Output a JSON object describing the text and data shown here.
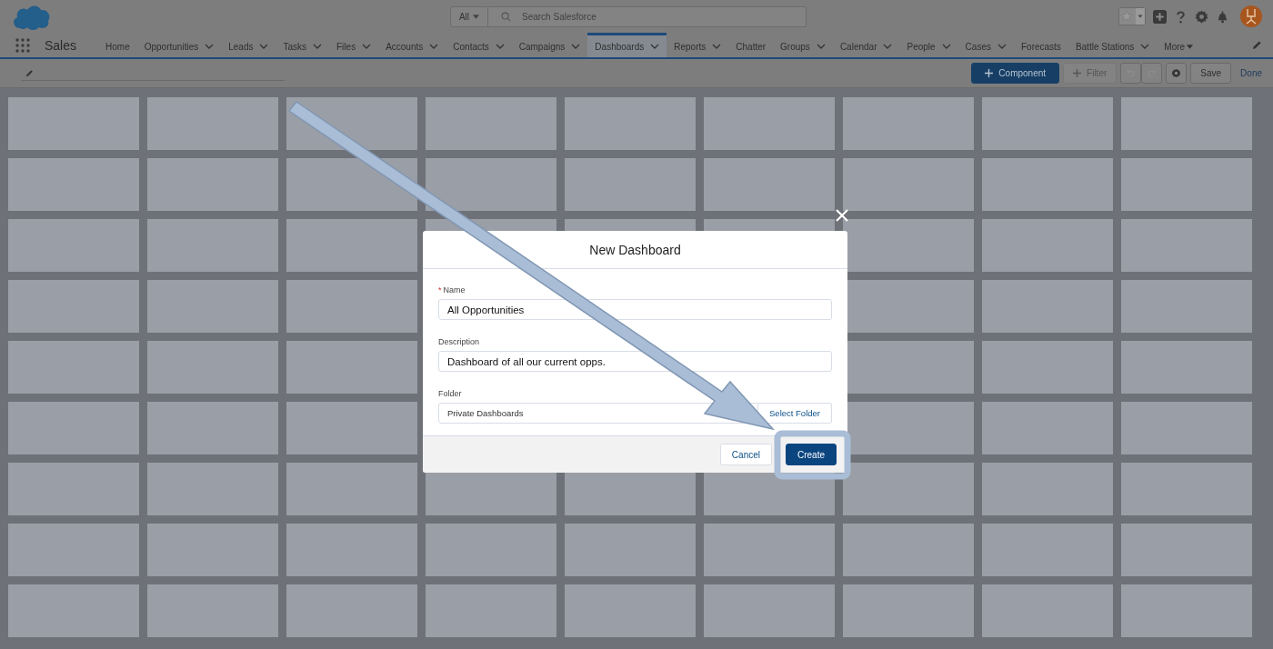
{
  "header": {
    "search_scope": "All",
    "search_placeholder": "Search Salesforce"
  },
  "app_name": "Sales",
  "nav": [
    {
      "label": "Home",
      "menu": false,
      "selected": false
    },
    {
      "label": "Opportunities",
      "menu": true,
      "selected": false
    },
    {
      "label": "Leads",
      "menu": true,
      "selected": false
    },
    {
      "label": "Tasks",
      "menu": true,
      "selected": false
    },
    {
      "label": "Files",
      "menu": true,
      "selected": false
    },
    {
      "label": "Accounts",
      "menu": true,
      "selected": false
    },
    {
      "label": "Contacts",
      "menu": true,
      "selected": false
    },
    {
      "label": "Campaigns",
      "menu": true,
      "selected": false
    },
    {
      "label": "Dashboards",
      "menu": true,
      "selected": true
    },
    {
      "label": "Reports",
      "menu": true,
      "selected": false
    },
    {
      "label": "Chatter",
      "menu": false,
      "selected": false
    },
    {
      "label": "Groups",
      "menu": true,
      "selected": false
    },
    {
      "label": "Calendar",
      "menu": true,
      "selected": false
    },
    {
      "label": "People",
      "menu": true,
      "selected": false
    },
    {
      "label": "Cases",
      "menu": true,
      "selected": false
    },
    {
      "label": "Forecasts",
      "menu": false,
      "selected": false
    },
    {
      "label": "Battle Stations",
      "menu": true,
      "selected": false
    },
    {
      "label": "More",
      "menu": true,
      "selected": false
    }
  ],
  "toolbar": {
    "component": "Component",
    "filter": "Filter",
    "filter_disabled": true,
    "save": "Save",
    "done": "Done"
  },
  "dialog": {
    "title": "New Dashboard",
    "fields": [
      {
        "label": "Name",
        "required_mark": "*",
        "value": "All Opportunities",
        "kind": "text"
      },
      {
        "label": "Description",
        "value": "Dashboard of all our current opps.",
        "kind": "text"
      },
      {
        "label": "Folder",
        "value": "Private Dashboards",
        "kind": "folder",
        "button": "Select Folder"
      }
    ],
    "cancel": "Cancel",
    "create": "Create"
  }
}
